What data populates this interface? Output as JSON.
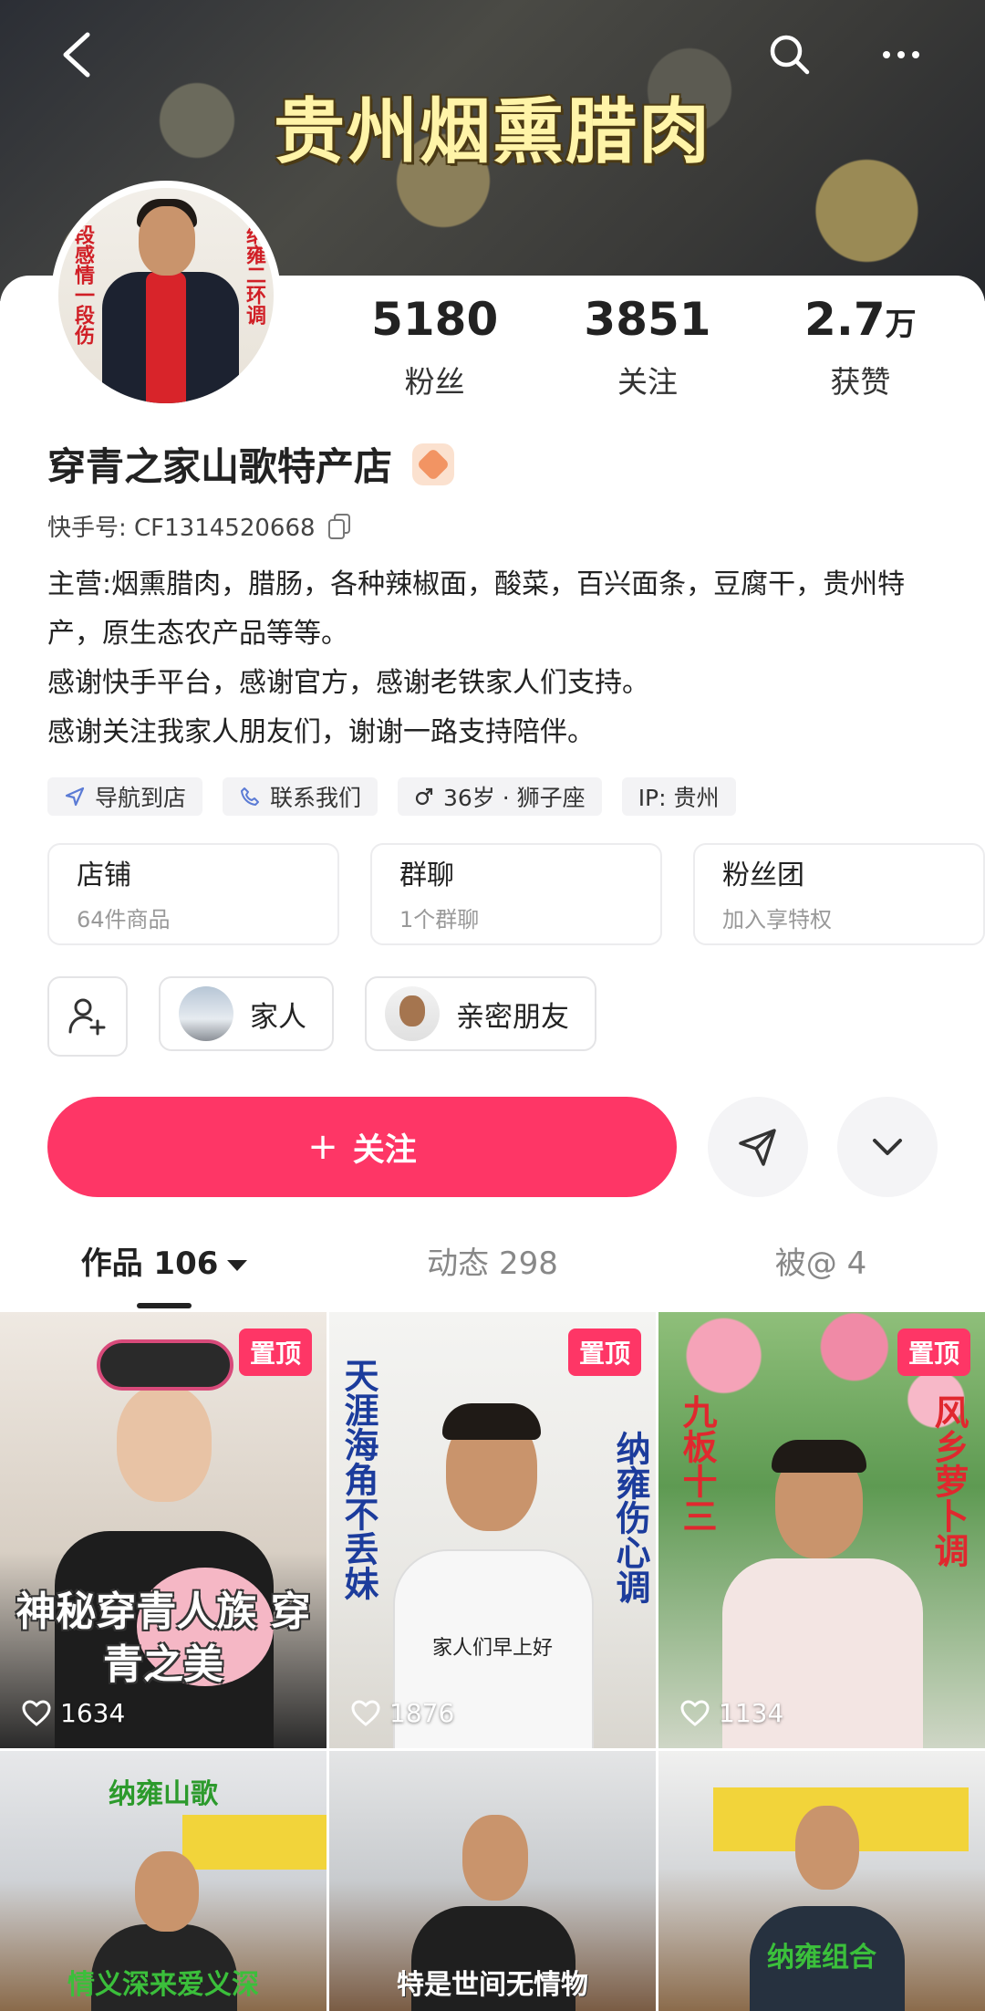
{
  "banner": {
    "title": "贵州烟熏腊肉"
  },
  "avatar": {
    "text_left": "段感情一段伤",
    "text_right": "纳雍二环调"
  },
  "stats": [
    {
      "num": "5180",
      "unit": "",
      "label": "粉丝"
    },
    {
      "num": "3851",
      "unit": "",
      "label": "关注"
    },
    {
      "num": "2.7",
      "unit": "万",
      "label": "获赞"
    }
  ],
  "profile": {
    "name": "穿青之家山歌特产店",
    "kuaishou_id": "快手号: CF1314520668",
    "bio": [
      "主营:烟熏腊肉，腊肠，各种辣椒面，酸菜，百兴面条，豆腐干，贵州特产，原生态农产品等等。",
      "感谢快手平台，感谢官方，感谢老铁家人们支持。",
      "感谢关注我家人朋友们，谢谢一路支持陪伴。"
    ]
  },
  "tags": {
    "navigate": "导航到店",
    "contact": "联系我们",
    "age": "36岁 · 狮子座",
    "ip": "IP: 贵州"
  },
  "entries": [
    {
      "title": "店铺",
      "sub": "64件商品"
    },
    {
      "title": "群聊",
      "sub": "1个群聊"
    },
    {
      "title": "粉丝团",
      "sub": "加入享特权"
    }
  ],
  "friends": [
    {
      "label": "家人"
    },
    {
      "label": "亲密朋友"
    }
  ],
  "actions": {
    "follow": "关注",
    "follow_plus": "+"
  },
  "tabs": [
    {
      "label": "作品 106"
    },
    {
      "label": "动态 298"
    },
    {
      "label": "被@ 4"
    }
  ],
  "videos": [
    {
      "pinned": "置顶",
      "likes": "1634",
      "caption": "神秘穿青人族 穿青之美"
    },
    {
      "pinned": "置顶",
      "likes": "1876",
      "caption": "家人们早上好",
      "left_text": "天涯海角不丢妹",
      "right_text": "纳雍伤心调"
    },
    {
      "pinned": "置顶",
      "likes": "1134",
      "left_text": "九板十三",
      "right_text": "风乡萝卜调"
    },
    {
      "top_text": "纳雍山歌",
      "bottom_text": "情义深来爱义深"
    },
    {
      "bottom_text": "特是世间无情物"
    },
    {
      "bottom_text": "纳雍组合"
    }
  ],
  "colors": {
    "accent": "#fe3666",
    "pin_bg": "#fe3666"
  }
}
